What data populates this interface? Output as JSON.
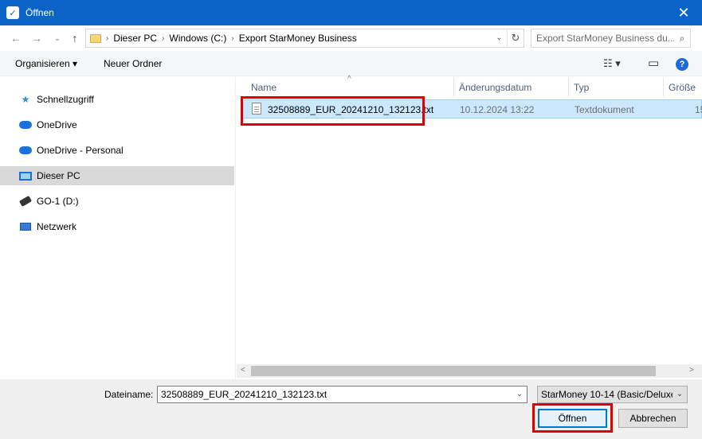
{
  "window": {
    "title": "Öffnen",
    "close_glyph": "✕",
    "icon": "starmoney-icon"
  },
  "nav": {
    "back_glyph": "←",
    "forward_glyph": "→",
    "recent_glyph": "⌄",
    "up_glyph": "↑",
    "breadcrumb": [
      "Dieser PC",
      "Windows (C:)",
      "Export StarMoney Business"
    ],
    "crumb_separator": "›",
    "dropdown_glyph": "⌄",
    "refresh_glyph": "↻",
    "search_placeholder": "Export StarMoney Business du...",
    "search_glyph": "⌕"
  },
  "toolbar": {
    "organize_label": "Organisieren ▾",
    "new_folder_label": "Neuer Ordner",
    "view_glyph": "☷ ▾",
    "preview_glyph": "▭",
    "help_glyph": "?"
  },
  "sidebar": {
    "items": [
      {
        "label": "Schnellzugriff",
        "icon": "star-icon"
      },
      {
        "label": "OneDrive",
        "icon": "cloud-icon"
      },
      {
        "label": "OneDrive - Personal",
        "icon": "cloud-icon"
      },
      {
        "label": "Dieser PC",
        "icon": "computer-icon",
        "selected": true
      },
      {
        "label": "GO-1 (D:)",
        "icon": "usb-drive-icon"
      },
      {
        "label": "Netzwerk",
        "icon": "network-icon"
      }
    ]
  },
  "columns": {
    "name": "Name",
    "date": "Änderungsdatum",
    "type": "Typ",
    "size": "Größe",
    "sort_glyph": "^"
  },
  "files": [
    {
      "name": "32508889_EUR_20241210_132123.txt",
      "date": "10.12.2024 13:22",
      "type": "Textdokument",
      "size": "15"
    }
  ],
  "scroll": {
    "left_glyph": "<",
    "right_glyph": ">"
  },
  "footer": {
    "filename_label": "Dateiname:",
    "filename_value": "32508889_EUR_20241210_132123.txt",
    "filetype_value": "StarMoney 10-14 (Basic/Deluxe",
    "dropdown_glyph": "⌄",
    "open_label": "Öffnen",
    "cancel_label": "Abbrechen"
  },
  "highlight_color": "#e00000"
}
